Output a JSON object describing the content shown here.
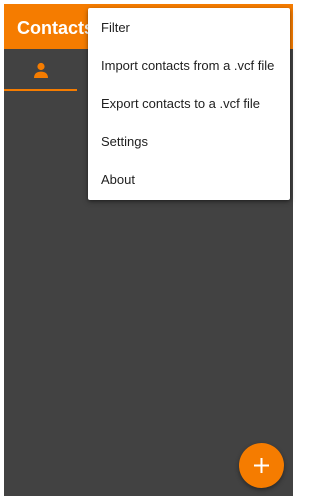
{
  "app": {
    "title": "Contacts"
  },
  "tabs": [
    {
      "icon": "person-icon",
      "selected": true
    }
  ],
  "menu": {
    "items": [
      {
        "label": "Filter"
      },
      {
        "label": "Import contacts from a .vcf file"
      },
      {
        "label": "Export contacts to a .vcf file"
      },
      {
        "label": "Settings"
      },
      {
        "label": "About"
      }
    ]
  },
  "fab": {
    "icon": "plus-icon"
  },
  "colors": {
    "accent": "#f57c00",
    "background": "#424242",
    "menu_background": "#ffffff",
    "menu_text": "#212121"
  }
}
